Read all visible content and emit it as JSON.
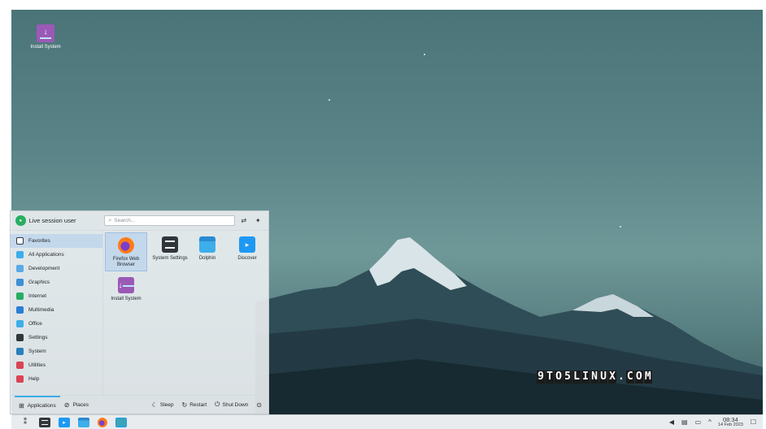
{
  "desktop": {
    "icon_label": "Install System",
    "watermark": [
      "9",
      "T",
      "O",
      "5",
      "L",
      "I",
      "N",
      "U",
      "X",
      ".",
      "C",
      "O",
      "M"
    ]
  },
  "launcher": {
    "user_name": "Live session user",
    "search_placeholder": "Search...",
    "categories": [
      {
        "label": "Favorites",
        "icon": "favorites-icon",
        "color": "#ffffff"
      },
      {
        "label": "All Applications",
        "icon": "all-apps-icon",
        "color": "#3daee9"
      },
      {
        "label": "Development",
        "icon": "development-icon",
        "color": "#5aa9e6"
      },
      {
        "label": "Graphics",
        "icon": "graphics-icon",
        "color": "#3d8fd6"
      },
      {
        "label": "Internet",
        "icon": "internet-icon",
        "color": "#27ae60"
      },
      {
        "label": "Multimedia",
        "icon": "multimedia-icon",
        "color": "#2a7fd4"
      },
      {
        "label": "Office",
        "icon": "office-icon",
        "color": "#3daee9"
      },
      {
        "label": "Settings",
        "icon": "settings-icon",
        "color": "#31363b"
      },
      {
        "label": "System",
        "icon": "system-icon",
        "color": "#2980b9"
      },
      {
        "label": "Utilities",
        "icon": "utilities-icon",
        "color": "#da4453"
      },
      {
        "label": "Help",
        "icon": "help-icon",
        "color": "#da4453"
      }
    ],
    "apps": [
      {
        "label": "Firefox Web Browser",
        "icon": "firefox-icon"
      },
      {
        "label": "System Settings",
        "icon": "system-settings-icon"
      },
      {
        "label": "Dolphin",
        "icon": "dolphin-icon"
      },
      {
        "label": "Discover",
        "icon": "discover-icon"
      },
      {
        "label": "Install System",
        "icon": "install-system-icon"
      }
    ],
    "footer": {
      "tab_applications": "Applications",
      "tab_places": "Places",
      "sleep": "Sleep",
      "restart": "Restart",
      "shut_down": "Shut Down"
    }
  },
  "taskbar": {
    "time": "08:34",
    "date": "14 Feb 2023"
  }
}
